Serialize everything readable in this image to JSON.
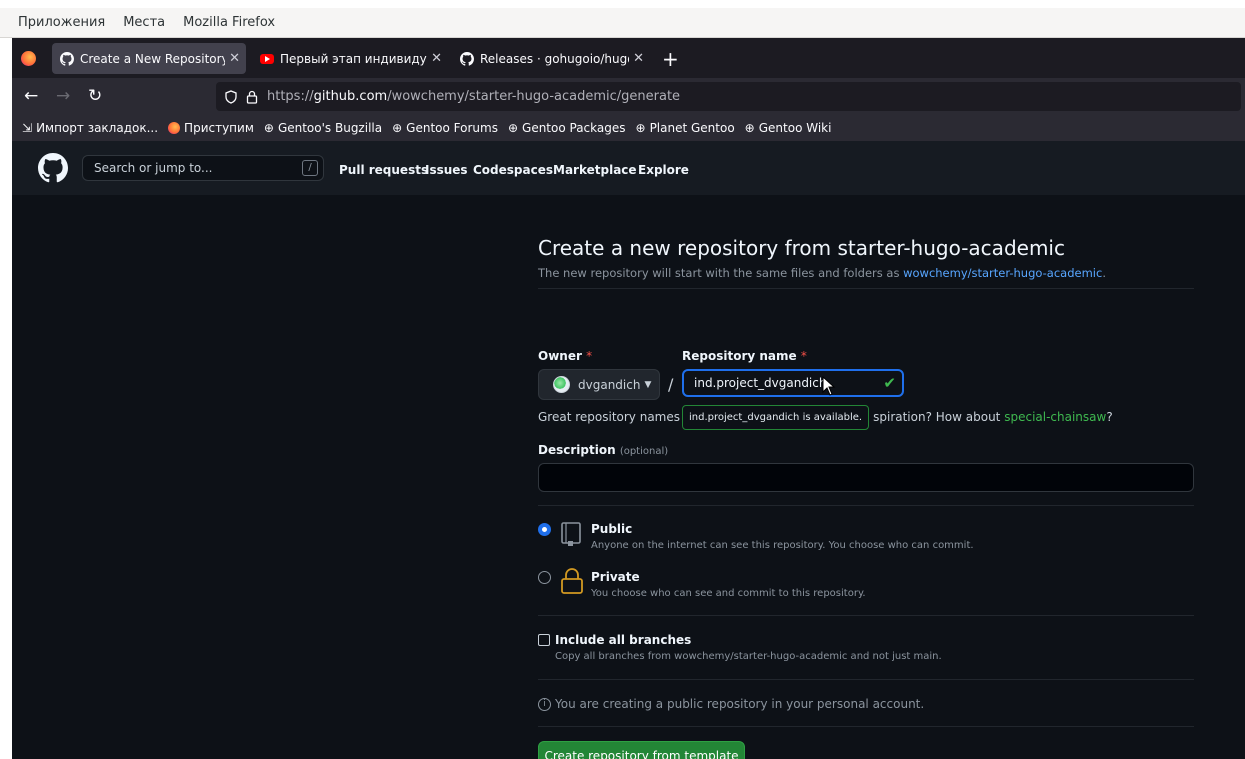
{
  "desktop": {
    "menu": [
      "Приложения",
      "Места",
      "Mozilla Firefox"
    ]
  },
  "browser": {
    "tabs": [
      {
        "label": "Create a New Repository fr",
        "icon": "github-icon",
        "active": true
      },
      {
        "label": "Первый этап индивидуал",
        "icon": "youtube-icon",
        "active": false
      },
      {
        "label": "Releases · gohugoio/hugo",
        "icon": "github-icon",
        "active": false
      }
    ],
    "url": {
      "prefix": "https://",
      "host": "github.com",
      "path": "/wowchemy/starter-hugo-academic/generate"
    },
    "bookmarks": [
      {
        "label": "Импорт закладок...",
        "icon": "import-icon"
      },
      {
        "label": "Приступим",
        "icon": "firefox-icon"
      },
      {
        "label": "Gentoo's Bugzilla",
        "icon": "globe-icon"
      },
      {
        "label": "Gentoo Forums",
        "icon": "globe-icon"
      },
      {
        "label": "Gentoo Packages",
        "icon": "globe-icon"
      },
      {
        "label": "Planet Gentoo",
        "icon": "globe-icon"
      },
      {
        "label": "Gentoo Wiki",
        "icon": "globe-icon"
      }
    ]
  },
  "github": {
    "search_placeholder": "Search or jump to...",
    "search_shortcut": "/",
    "nav": [
      "Pull requests",
      "Issues",
      "Codespaces",
      "Marketplace",
      "Explore"
    ]
  },
  "form": {
    "title": "Create a new repository from starter-hugo-academic",
    "subtitle": "The new repository will start with the same files and folders as",
    "template_link": "wowchemy/starter-hugo-academic",
    "subtitle_end": ".",
    "owner_label": "Owner",
    "repo_label": "Repository name",
    "required_mark": "*",
    "owner_value": "dvgandich",
    "separator": "/",
    "repo_value": "ind.project_dvgandich",
    "hint_pre": "Great repository names ar",
    "hint_mid": "spiration? How about",
    "suggestion": "special-chainsaw",
    "hint_end": "?",
    "tooltip": "ind.project_dvgandich is available.",
    "description_label": "Description",
    "description_optional": "(optional)",
    "description_value": "",
    "visibility": [
      {
        "title": "Public",
        "desc": "Anyone on the internet can see this repository. You choose who can commit.",
        "selected": true
      },
      {
        "title": "Private",
        "desc": "You choose who can see and commit to this repository.",
        "selected": false
      }
    ],
    "include_branches": {
      "title": "Include all branches",
      "desc": "Copy all branches from wowchemy/starter-hugo-academic and not just main.",
      "checked": false
    },
    "notice": "You are creating a public repository in your personal account.",
    "submit": "Create repository from template"
  },
  "colors": {
    "accent": "#238636",
    "link": "#58a6ff",
    "background": "#0d1117",
    "header": "#161b22"
  }
}
